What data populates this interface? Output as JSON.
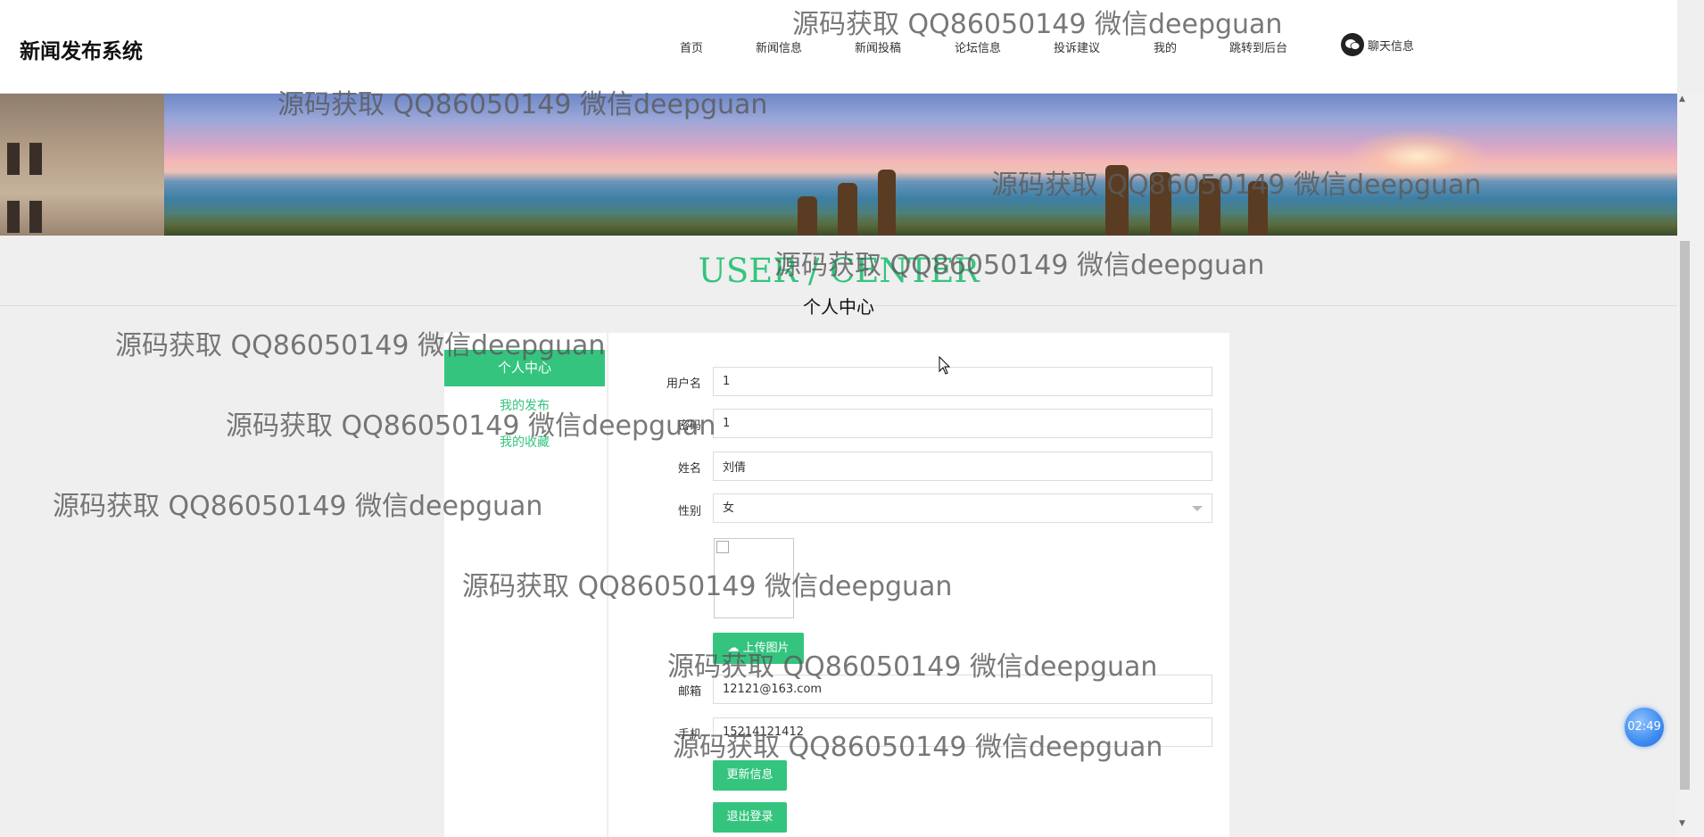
{
  "header": {
    "logo": "新闻发布系统",
    "nav": [
      "首页",
      "新闻信息",
      "新闻投稿",
      "论坛信息",
      "投诉建议",
      "我的",
      "跳转到后台"
    ],
    "chat_label": "聊天信息"
  },
  "section": {
    "title_en": "USER / CENTER",
    "title_cn": "个人中心"
  },
  "sidebar": {
    "active": "个人中心",
    "links": [
      "我的发布",
      "我的收藏"
    ]
  },
  "form": {
    "username_label": "用户名",
    "username_value": "1",
    "password_label": "密码",
    "password_value": "1",
    "name_label": "姓名",
    "name_value": "刘倩",
    "gender_label": "性别",
    "gender_value": "女",
    "upload_label": "上传图片",
    "email_label": "邮箱",
    "email_value": "12121@163.com",
    "phone_label": "手机",
    "phone_value": "15214121412",
    "update_button": "更新信息",
    "logout_button": "退出登录"
  },
  "watermark": "源码获取 QQ86050149 微信deepguan",
  "timer": "02:49",
  "colors": {
    "accent": "#34c47e"
  }
}
